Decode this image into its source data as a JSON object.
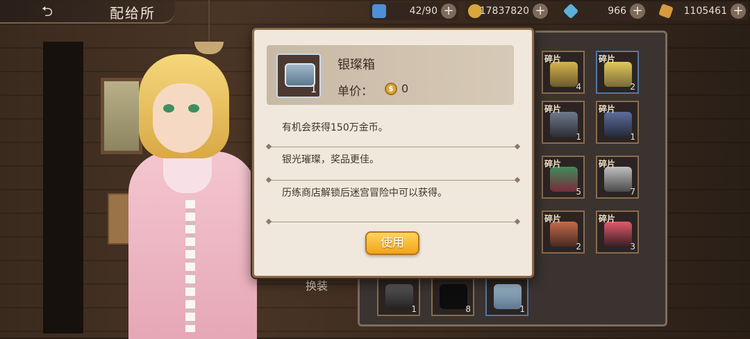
{
  "header": {
    "title": "配给所"
  },
  "resources": [
    {
      "icon": "energy-icon",
      "value": "42/90",
      "color": "#4f8fd6"
    },
    {
      "icon": "gold-coin-icon",
      "value": "17837820",
      "color": "#d9a63a"
    },
    {
      "icon": "blue-crystal-icon",
      "value": "966",
      "color": "#5cb0d8"
    },
    {
      "icon": "amber-gem-icon",
      "value": "1105461",
      "color": "#d89a3a"
    }
  ],
  "dialog": {
    "item_name": "银璨箱",
    "item_count": "1",
    "price_label": "单价：",
    "price_value": "0",
    "descriptions": [
      "有机会获得150万金币。",
      "银光璀璨，奖品更佳。",
      "历练商店解锁后迷宫冒险中可以获得。"
    ],
    "use_button": "使用"
  },
  "side_label": "换装",
  "inventory": [
    {
      "tag": "碎片",
      "count": "4"
    },
    {
      "tag": "碎片",
      "count": "2"
    },
    {
      "tag": "碎片",
      "count": "1"
    },
    {
      "tag": "碎片",
      "count": "1"
    },
    {
      "tag": "碎片",
      "count": "5"
    },
    {
      "tag": "碎片",
      "count": "7"
    },
    {
      "tag": "碎片",
      "count": "2"
    },
    {
      "tag": "碎片",
      "count": "3"
    },
    {
      "tag": "",
      "count": "1"
    },
    {
      "tag": "",
      "count": "8"
    },
    {
      "tag": "",
      "count": "1"
    }
  ]
}
